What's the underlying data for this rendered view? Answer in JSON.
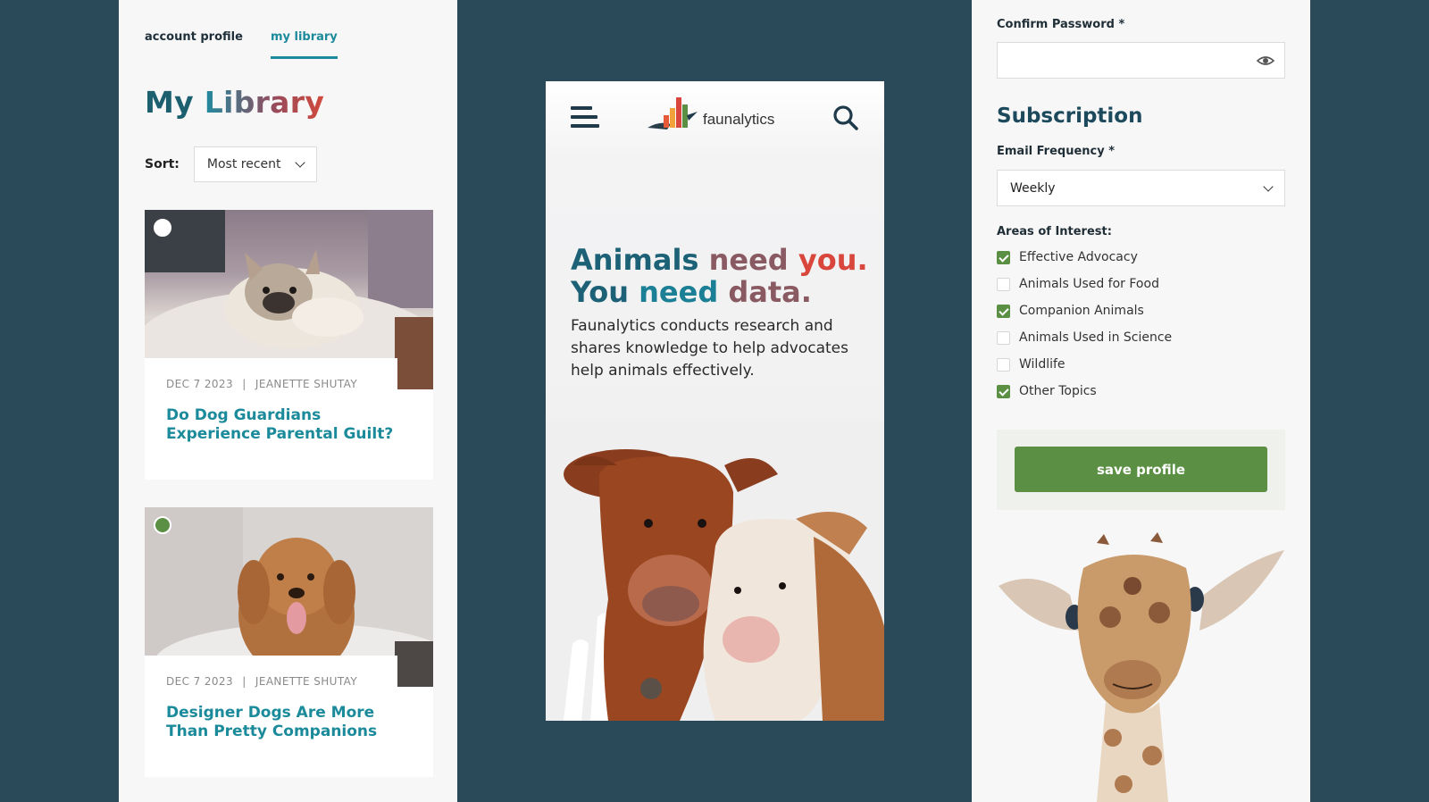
{
  "account": {
    "tabs": [
      {
        "label": "account profile",
        "active": false
      },
      {
        "label": "my library",
        "active": true
      }
    ],
    "title_part1": "My",
    "title_part2": "Library",
    "sort_label": "Sort:",
    "sort_value": "Most recent",
    "articles": [
      {
        "date": "DEC 7 2023",
        "separator": "|",
        "author": "JEANETTE SHUTAY",
        "title": "Do Dog Guardians Experience Parental Guilt?",
        "selected": false
      },
      {
        "date": "DEC 7 2023",
        "separator": "|",
        "author": "JEANETTE SHUTAY",
        "title": "Designer Dogs Are More Than Pretty Companions",
        "selected": true
      }
    ]
  },
  "mobile": {
    "logo_text": "faunalytics",
    "hero": {
      "w1": "Animals",
      "w2": "need",
      "w3": "you.",
      "w4": "You",
      "w5": "need",
      "w6": "data."
    },
    "description": "Faunalytics conducts research and shares knowledge to help advocates help animals effectively."
  },
  "profile": {
    "confirm_password_label": "Confirm Password *",
    "confirm_password_value": "",
    "subscription_title": "Subscription",
    "email_frequency_label": "Email Frequency *",
    "email_frequency_value": "Weekly",
    "areas_label": "Areas of Interest:",
    "interests": [
      {
        "label": "Effective Advocacy",
        "checked": true
      },
      {
        "label": "Animals Used for Food",
        "checked": false
      },
      {
        "label": "Companion Animals",
        "checked": true
      },
      {
        "label": "Animals Used in Science",
        "checked": false
      },
      {
        "label": "Wildlife",
        "checked": false
      },
      {
        "label": "Other Topics",
        "checked": true
      }
    ],
    "save_label": "save profile"
  },
  "colors": {
    "background": "#2a4a5a",
    "accent_teal": "#1b8a9a",
    "accent_green": "#5b8f44",
    "accent_red": "#d8463c",
    "navy": "#1c4a5c"
  },
  "icons": [
    "hamburger-menu-icon",
    "search-icon",
    "eye-icon",
    "chevron-down-icon",
    "faunalytics-logo"
  ]
}
